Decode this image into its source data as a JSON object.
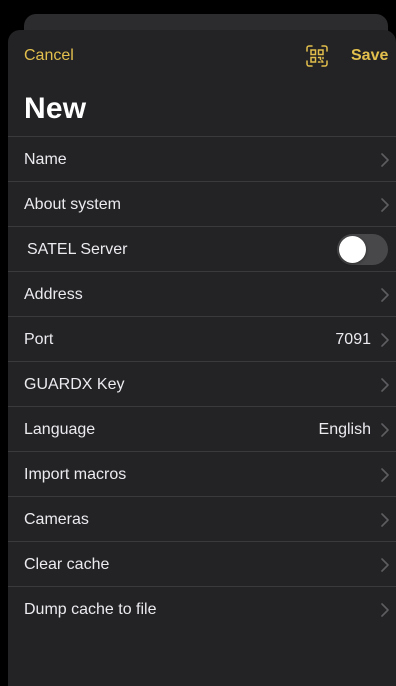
{
  "navbar": {
    "cancel_label": "Cancel",
    "qr_icon": "qr-code-scan-icon",
    "save_label": "Save"
  },
  "title": "New",
  "rows": [
    {
      "label": "Name",
      "type": "chevron"
    },
    {
      "label": "About system",
      "type": "chevron"
    },
    {
      "label": "SATEL Server",
      "type": "toggle",
      "on": false
    },
    {
      "label": "Address",
      "type": "chevron"
    },
    {
      "label": "Port",
      "value": "7091",
      "type": "chevron"
    },
    {
      "label": "GUARDX Key",
      "type": "chevron"
    },
    {
      "label": "Language",
      "value": "English",
      "type": "chevron"
    },
    {
      "label": "Import macros",
      "type": "chevron"
    },
    {
      "label": "Cameras",
      "type": "chevron"
    },
    {
      "label": "Clear cache",
      "type": "chevron"
    },
    {
      "label": "Dump cache to file",
      "type": "chevron"
    }
  ],
  "colors": {
    "accent": "#e3bf4d",
    "sheet": "#232325",
    "separator": "#3a3a3c",
    "text": "#ebebf0",
    "chevron": "#5e5e62"
  }
}
